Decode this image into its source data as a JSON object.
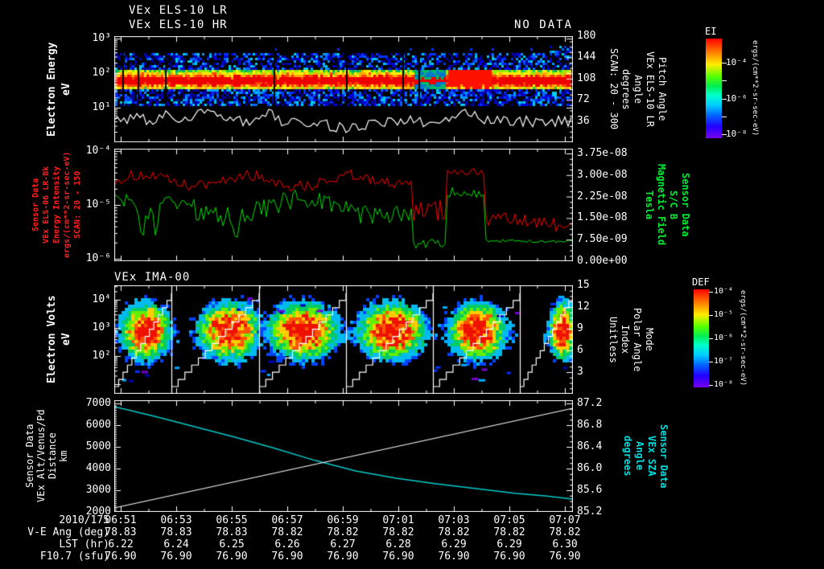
{
  "header": {
    "title_line1": "VEx ELS-10 LR",
    "title_line2": "VEx ELS-10 HR",
    "no_data": "NO DATA"
  },
  "panel1": {
    "left_label_lines": [
      "Electron Energy",
      "eV"
    ],
    "left_ticks": [
      "10³",
      "10²",
      "10¹"
    ],
    "right_ticks": [
      "180",
      "144",
      "108",
      "72",
      "36"
    ],
    "right_label_lines": [
      "Pitch Angle",
      "VEx ELS-10 LR",
      "Angle",
      "degrees",
      "SCAN: 20 - 300"
    ],
    "colorbar": {
      "title": "EI",
      "tick_labels": [
        "10⁻⁴",
        "10⁻⁶",
        "10⁻⁸"
      ],
      "units": "ergs/(cm**2-sr-sec-eV)"
    }
  },
  "panel2": {
    "left_label_lines": [
      "Sensor Data",
      "VEx ELS-06 LR-Bk",
      "Energy Intensity",
      "ergs/(cm**2-sr-sec-eV)",
      "SCAN: 20 - 150"
    ],
    "left_ticks": [
      "10⁻⁴",
      "10⁻⁵",
      "10⁻⁶"
    ],
    "right_ticks": [
      "3.75e-08",
      "3.00e-08",
      "2.25e-08",
      "1.50e-08",
      "7.50e-09",
      "0.00e+00"
    ],
    "right_label_lines": [
      "Sensor Data",
      "S/C B",
      "Magnetic Field",
      "Tesla"
    ],
    "trace_colors": {
      "intensity": "#ff0000",
      "magnetic_field": "#00dd00"
    }
  },
  "panel3": {
    "title": "VEx IMA-00",
    "left_label_lines": [
      "Electron Volts",
      "eV"
    ],
    "left_ticks": [
      "10⁴",
      "10³",
      "10²"
    ],
    "right_ticks": [
      "15",
      "12",
      "9",
      "6",
      "3"
    ],
    "right_label_lines": [
      "Mode",
      "Polar Angle",
      "Index",
      "Unitless"
    ],
    "colorbar": {
      "title": "DEF",
      "tick_labels": [
        "10⁻⁴",
        "10⁻⁵",
        "10⁻⁶",
        "10⁻⁷",
        "10⁻⁸"
      ],
      "units": "ergs/(cm**2-sr-sec-eV)"
    }
  },
  "panel4": {
    "left_label_lines": [
      "Sensor Data",
      "VEx Alt/Venus/Pd",
      "Distance",
      "km"
    ],
    "left_ticks": [
      "7000",
      "6000",
      "5000",
      "4000",
      "3000",
      "2000"
    ],
    "right_ticks": [
      "87.2",
      "86.8",
      "86.4",
      "86.0",
      "85.6",
      "85.2"
    ],
    "right_label_lines": [
      "Sensor Data",
      "VEx SZA",
      "Angle",
      "degrees"
    ],
    "trace_colors": {
      "distance": "#ffffff",
      "sza": "#00cccc"
    }
  },
  "bottom": {
    "date": "2010/175",
    "times": [
      "06:51",
      "06:53",
      "06:55",
      "06:57",
      "06:59",
      "07:01",
      "07:03",
      "07:05",
      "07:07"
    ],
    "rows": [
      {
        "label": "V-E Ang (deg)",
        "values": [
          "78.83",
          "78.83",
          "78.83",
          "78.82",
          "78.82",
          "78.82",
          "78.82",
          "78.82",
          "78.82"
        ]
      },
      {
        "label": "LST (hr)",
        "values": [
          "6.22",
          "6.24",
          "6.25",
          "6.26",
          "6.27",
          "6.28",
          "6.29",
          "6.29",
          "6.30"
        ]
      },
      {
        "label": "F10.7 (sfu)",
        "values": [
          "76.90",
          "76.90",
          "76.90",
          "76.90",
          "76.90",
          "76.90",
          "76.90",
          "76.90",
          "76.90"
        ]
      }
    ]
  },
  "chart_data": [
    {
      "type": "heatmap",
      "title": "VEx ELS-10 LR (HR: NO DATA)",
      "xlabel": "UT 2010/175 06:51 - 07:07",
      "ylabel": "Electron Energy (eV)",
      "yscale": "log",
      "ylim": [
        1,
        1000
      ],
      "y2label": "Pitch Angle, VEx ELS-10 LR, Angle, degrees, SCAN: 20 - 300",
      "y2lim": [
        0,
        180
      ],
      "zlabel": "EI ergs/(cm**2-sr-sec-eV)",
      "zlim": [
        1e-08,
        0.0001
      ],
      "description": "Continuous electron spectrogram: intense red band near 30-100 eV flanked above and below by blue/cyan speckle (5-500 eV); thin black data-gap columns; white count-rate trace along panel bottom; brighter thicker red section 07:03-07:05 after a weak/green interval 07:01:30-07:03."
    },
    {
      "type": "line",
      "ylabel": "Sensor Data VEx ELS-06 LR-Bk Energy Intensity ergs/(cm**2-sr-sec-eV) SCAN: 20 - 150",
      "yscale": "log",
      "ylim": [
        1e-06,
        0.0001
      ],
      "y2label": "Sensor Data S/C B Magnetic Field (Tesla)",
      "y2lim": [
        0,
        3.75e-08
      ],
      "series": [
        {
          "name": "Energy Intensity (red, left log axis)",
          "x": [
            "06:51",
            "06:55",
            "06:59",
            "07:01:30",
            "07:03",
            "07:04",
            "07:05",
            "07:07"
          ],
          "y": [
            2.8e-05,
            2.6e-05,
            2.7e-05,
            7e-06,
            4.2e-05,
            8e-06,
            5e-06,
            3.8e-06
          ]
        },
        {
          "name": "S/C B magnetic field (green, right linear axis, Tesla)",
          "x": [
            "06:51",
            "06:55",
            "06:59",
            "07:01:30",
            "07:03",
            "07:04",
            "07:05",
            "07:07"
          ],
          "y": [
            2.3e-08,
            2e-08,
            2.1e-08,
            9e-09,
            2.4e-08,
            8.2e-09,
            7.9e-09,
            7.8e-09
          ]
        }
      ]
    },
    {
      "type": "heatmap",
      "title": "VEx IMA-00",
      "ylabel": "Electron Volts (eV)",
      "yscale": "log",
      "ylim": [
        10,
        30000
      ],
      "y2label": "Mode / Polar Angle Index (Unitless)",
      "y2lim": [
        0,
        15
      ],
      "zlabel": "DEF ergs/(cm**2-sr-sec-eV)",
      "zlim": [
        1e-08,
        0.0001
      ],
      "description": "Six ion sweeps separated by vertical white lines; each sweep a pixelated blob centered near 300-1000 eV with red core and yellow/green/cyan/blue halo plus scattered blue dashes; a white stair-step polar-angle-index line climbs bottom-to-top across each sweep."
    },
    {
      "type": "line",
      "ylabel": "Sensor Data VEx Alt/Venus/Pd Distance (km)",
      "ylim": [
        2000,
        7000
      ],
      "y2label": "Sensor Data VEx SZA Angle (degrees)",
      "y2lim": [
        85.2,
        87.2
      ],
      "series": [
        {
          "name": "Distance km (white, rising straight line, left axis)",
          "x": [
            "06:51",
            "06:55",
            "06:59",
            "07:03",
            "07:07"
          ],
          "y": [
            2185,
            3330,
            4480,
            5630,
            6780
          ]
        },
        {
          "name": "VEx SZA degrees (cyan, falling flattening curve, right axis)",
          "x": [
            "06:51",
            "06:55",
            "06:59",
            "07:03",
            "07:07"
          ],
          "y": [
            87.14,
            86.5,
            85.97,
            85.66,
            85.44
          ]
        }
      ]
    }
  ]
}
